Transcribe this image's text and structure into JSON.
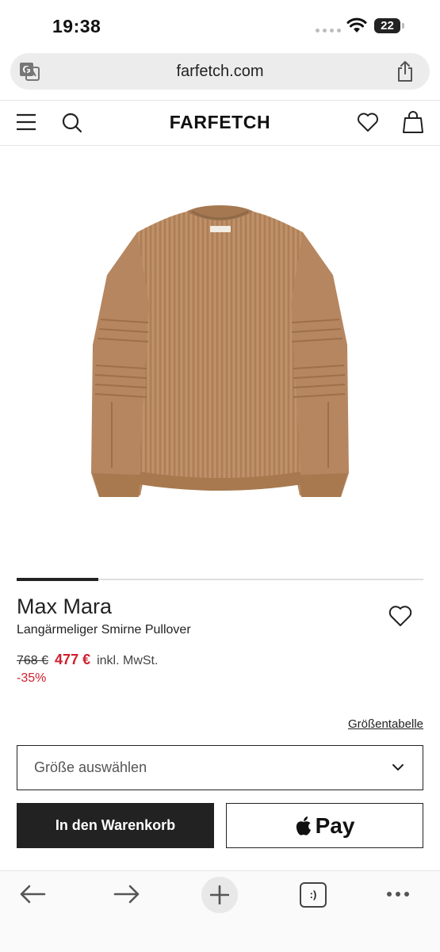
{
  "status_bar": {
    "time": "19:38",
    "battery": "22"
  },
  "browser": {
    "url": "farfetch.com"
  },
  "header": {
    "logo": "FARFETCH"
  },
  "product": {
    "brand": "Max Mara",
    "name": "Langärmeliger Smirne Pullover",
    "old_price": "768 €",
    "sale_price": "477 €",
    "tax_note": "inkl. MwSt.",
    "discount": "-35%",
    "sweater_label": "Max Mara"
  },
  "size": {
    "guide_label": "Größentabelle",
    "select_placeholder": "Größe auswählen"
  },
  "actions": {
    "add_to_bag": "In den Warenkorb",
    "apple_pay": "Pay"
  },
  "bottom_nav": {
    "tabs_label": ":)"
  },
  "colors": {
    "sale": "#d0202e",
    "sweater": "#b98a62",
    "primary_button": "#222222"
  },
  "icons": [
    "translate-icon",
    "share-icon",
    "menu-icon",
    "search-icon",
    "wishlist-icon",
    "bag-icon",
    "chevron-down-icon",
    "apple-icon",
    "back-arrow-icon",
    "forward-arrow-icon",
    "plus-icon",
    "more-icon"
  ]
}
